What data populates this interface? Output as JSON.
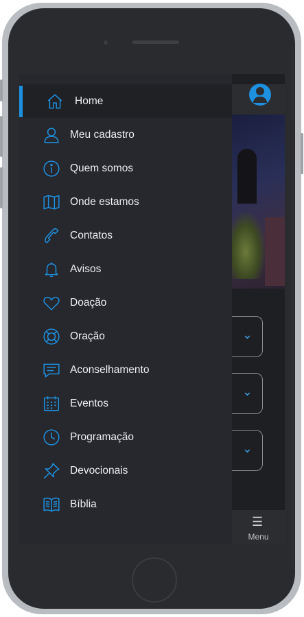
{
  "colors": {
    "accent": "#1e90e0",
    "drawer_bg": "#26282d",
    "text": "#eceef0"
  },
  "drawer": {
    "items": [
      {
        "label": "Home",
        "icon": "home-icon",
        "active": true
      },
      {
        "label": "Meu cadastro",
        "icon": "user-icon"
      },
      {
        "label": "Quem somos",
        "icon": "info-icon"
      },
      {
        "label": "Onde estamos",
        "icon": "map-icon"
      },
      {
        "label": "Contatos",
        "icon": "phone-icon"
      },
      {
        "label": "Avisos",
        "icon": "bell-icon"
      },
      {
        "label": "Doação",
        "icon": "heart-icon"
      },
      {
        "label": "Oração",
        "icon": "lifebuoy-icon"
      },
      {
        "label": "Aconselhamento",
        "icon": "chat-icon"
      },
      {
        "label": "Eventos",
        "icon": "calendar-icon"
      },
      {
        "label": "Programação",
        "icon": "clock-icon"
      },
      {
        "label": "Devocionais",
        "icon": "pin-icon"
      },
      {
        "label": "Bíblia",
        "icon": "book-icon"
      }
    ]
  },
  "bottom_nav": {
    "menu_label": "Menu",
    "menu_icon": "hamburger-icon"
  },
  "header": {
    "profile_icon": "account-circle-icon"
  }
}
